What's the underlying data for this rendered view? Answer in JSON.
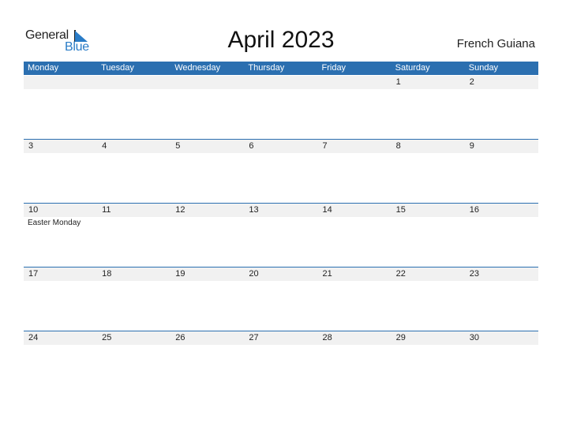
{
  "logo": {
    "word1": "General",
    "word2": "Blue"
  },
  "title": "April 2023",
  "country": "French Guiana",
  "colors": {
    "header_bg": "#2b6fb0",
    "strip_bg": "#f1f1f1",
    "logo_blue": "#2a7cc7"
  },
  "weekdays": [
    "Monday",
    "Tuesday",
    "Wednesday",
    "Thursday",
    "Friday",
    "Saturday",
    "Sunday"
  ],
  "weeks": [
    {
      "days": [
        "",
        "",
        "",
        "",
        "",
        "1",
        "2"
      ],
      "events": [
        "",
        "",
        "",
        "",
        "",
        "",
        ""
      ]
    },
    {
      "days": [
        "3",
        "4",
        "5",
        "6",
        "7",
        "8",
        "9"
      ],
      "events": [
        "",
        "",
        "",
        "",
        "",
        "",
        ""
      ]
    },
    {
      "days": [
        "10",
        "11",
        "12",
        "13",
        "14",
        "15",
        "16"
      ],
      "events": [
        "Easter Monday",
        "",
        "",
        "",
        "",
        "",
        ""
      ]
    },
    {
      "days": [
        "17",
        "18",
        "19",
        "20",
        "21",
        "22",
        "23"
      ],
      "events": [
        "",
        "",
        "",
        "",
        "",
        "",
        ""
      ]
    },
    {
      "days": [
        "24",
        "25",
        "26",
        "27",
        "28",
        "29",
        "30"
      ],
      "events": [
        "",
        "",
        "",
        "",
        "",
        "",
        ""
      ]
    }
  ]
}
